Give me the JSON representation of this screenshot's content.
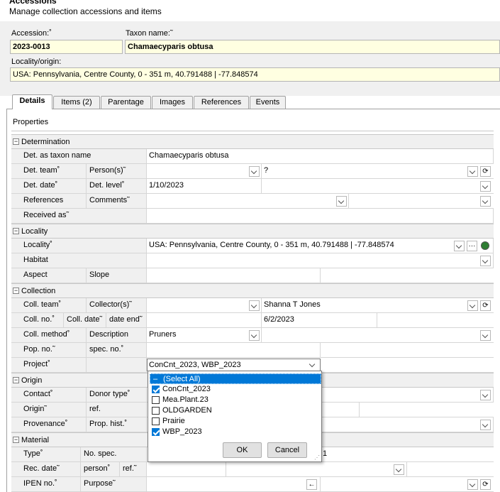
{
  "header": {
    "title": "Accessions",
    "subtitle": "Manage collection accessions and items"
  },
  "accession": {
    "accession_label": "Accession:˚",
    "accession_value": "2023-0013",
    "taxon_label": "Taxon name:˜",
    "taxon_value": "Chamaecyparis obtusa",
    "locality_label": "Locality/origin:",
    "locality_value": "USA: Pennsylvania, Centre County, 0 - 351 m, 40.791488 | -77.848574"
  },
  "tabs": [
    {
      "label": "Details",
      "active": true
    },
    {
      "label": "Items (2)",
      "active": false
    },
    {
      "label": "Parentage",
      "active": false
    },
    {
      "label": "Images",
      "active": false
    },
    {
      "label": "References",
      "active": false
    },
    {
      "label": "Events",
      "active": false
    }
  ],
  "properties_label": "Properties",
  "sections": {
    "determination": "Determination",
    "locality": "Locality",
    "collection": "Collection",
    "origin": "Origin",
    "material": "Material"
  },
  "rows": {
    "det_taxon": {
      "label": "Det. as taxon name",
      "value": "Chamaecyparis obtusa"
    },
    "det_team": {
      "label": "Det. team˚",
      "label2": "Person(s)˜",
      "value2": "?"
    },
    "det_date": {
      "label": "Det. date˚",
      "label2": "Det. level˚",
      "value": "1/10/2023"
    },
    "references": {
      "label": "References",
      "label2": "Comments˜"
    },
    "received_as": {
      "label": "Received as˜"
    },
    "locality": {
      "label": "Locality˚",
      "value": "USA: Pennsylvania, Centre County, 0 - 351 m, 40.791488 | -77.848574"
    },
    "habitat": {
      "label": "Habitat"
    },
    "aspect": {
      "label": "Aspect",
      "label2": "Slope"
    },
    "coll_team": {
      "label": "Coll. team˚",
      "label2": "Collector(s)˜",
      "value2": "Shanna T Jones"
    },
    "coll_no": {
      "label": "Coll. no.˚",
      "label2": "Coll. date˜",
      "label3": "date end˜",
      "value2": "6/2/2023"
    },
    "coll_method": {
      "label": "Coll. method˚",
      "label2": "Description",
      "value": "Pruners"
    },
    "pop_no": {
      "label": "Pop. no.˜",
      "label2": "spec. no.˚"
    },
    "project": {
      "label": "Project˚",
      "value": "ConCnt_2023, WBP_2023"
    },
    "contact": {
      "label": "Contact˚",
      "label2": "Donor type˚"
    },
    "origin": {
      "label": "Origin˜",
      "label2": "ref."
    },
    "provenance": {
      "label": "Provenance˚",
      "label2": "Prop. hist.˚"
    },
    "type": {
      "label": "Type˚",
      "label2": "No. spec.",
      "value2": "1"
    },
    "rec_date": {
      "label": "Rec. date˜",
      "label2": "person˚",
      "label3": "ref.˜"
    },
    "ipen": {
      "label": "IPEN no.˚",
      "label2": "Purpose˜"
    }
  },
  "project_popup": {
    "items": [
      {
        "label": "(Select All)",
        "checked": "partial"
      },
      {
        "label": "ConCnt_2023",
        "checked": true
      },
      {
        "label": "Mea.Plant.23",
        "checked": false
      },
      {
        "label": "OLDGARDEN",
        "checked": false
      },
      {
        "label": "Prairie",
        "checked": false
      },
      {
        "label": "WBP_2023",
        "checked": true
      }
    ],
    "ok": "OK",
    "cancel": "Cancel"
  }
}
